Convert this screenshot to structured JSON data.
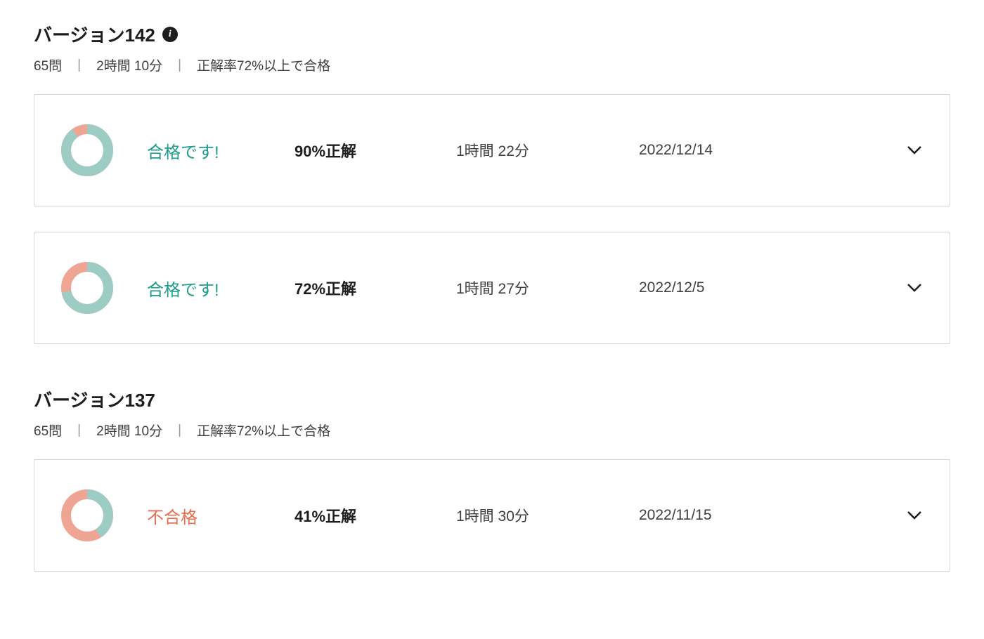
{
  "colors": {
    "pass_green": "#9dccc5",
    "fail_red": "#efa593",
    "status_pass": "#1e9d8b",
    "status_fail": "#e76f51"
  },
  "sections": [
    {
      "title": "バージョン142",
      "show_info": true,
      "meta_questions": "65問",
      "meta_duration": "2時間 10分",
      "meta_passcond": "正解率72%以上で合格",
      "attempts": [
        {
          "status_label": "合格です!",
          "status_key": "pass",
          "score_label": "90%正解",
          "duration_label": "1時間 22分",
          "date_label": "2022/12/14",
          "correct_pct": 90
        },
        {
          "status_label": "合格です!",
          "status_key": "pass",
          "score_label": "72%正解",
          "duration_label": "1時間 27分",
          "date_label": "2022/12/5",
          "correct_pct": 72
        }
      ]
    },
    {
      "title": "バージョン137",
      "show_info": false,
      "meta_questions": "65問",
      "meta_duration": "2時間 10分",
      "meta_passcond": "正解率72%以上で合格",
      "attempts": [
        {
          "status_label": "不合格",
          "status_key": "fail",
          "score_label": "41%正解",
          "duration_label": "1時間 30分",
          "date_label": "2022/11/15",
          "correct_pct": 41
        }
      ]
    }
  ]
}
